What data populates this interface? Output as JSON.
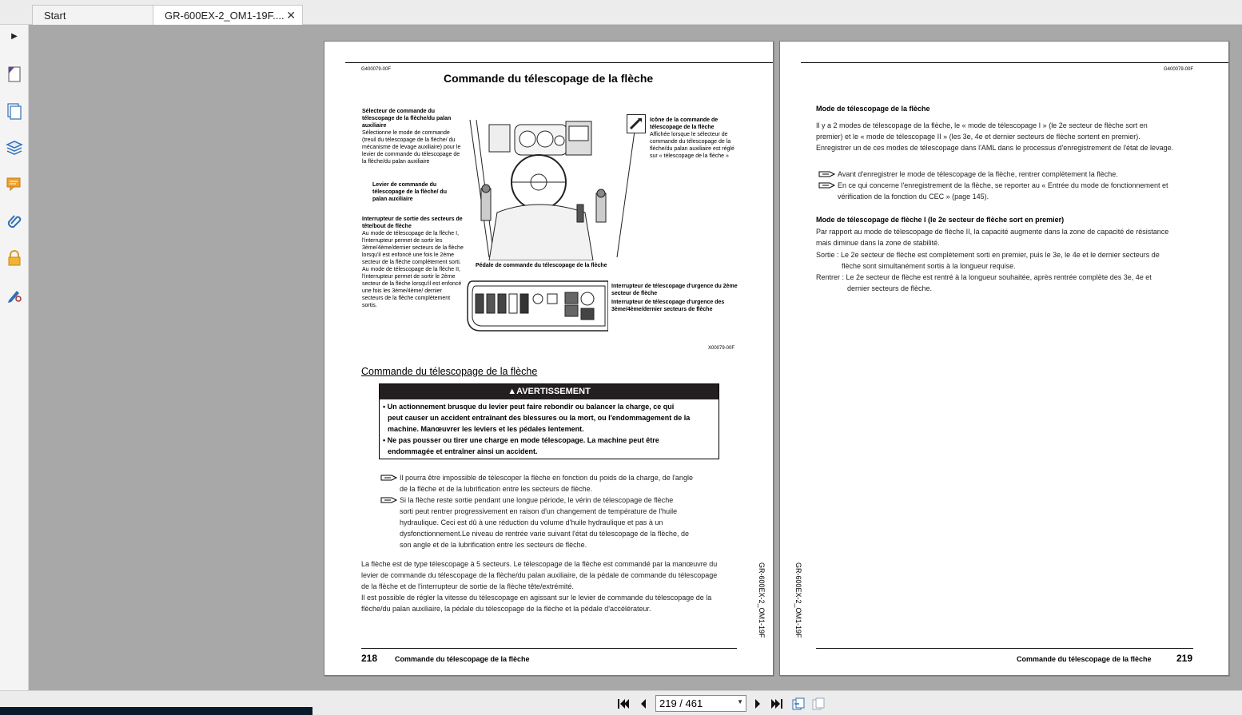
{
  "tabs": [
    {
      "label": "Start"
    },
    {
      "label": "GR-600EX-2_OM1-19F....",
      "close": "✕"
    }
  ],
  "sidebar": {
    "expand_arrow": "▶",
    "items": [
      "page-thumbnails",
      "layers-pages",
      "layers",
      "comments",
      "attachments",
      "security",
      "sign"
    ]
  },
  "left_page": {
    "doc_code": "G400079-00F",
    "title": "Commande du télescopage de la flèche",
    "callouts": {
      "c1_title": "Sélecteur de commande du télescopage de la flèche/du palan auxiliaire",
      "c1_text": "Sélectionne le mode de commande (treuil du télescopage de la flèche/ du mécanisme de levage auxiliaire) pour le levier de commande du télescopage de la flèche/du palan auxiliaire",
      "c2_title": "Levier de commande du télescopage de la flèche/ du palan auxiliaire",
      "c3_title": "Interrupteur de sortie des secteurs de tête/bout de flèche",
      "c3_text": "Au mode de télescopage de la flèche I, l'interrupteur permet de sortir les 3ème/4ème/dernier secteurs de la flèche lorsqu'il est enfoncé une fois le 2ème secteur de la flèche complètement sorti. Au mode de télescopage de la flèche II, l'interrupteur permet de sortir le 2ème secteur de la flèche lorsqu'il est enfoncé une fois les 3ème/4ème/ dernier secteurs de la flèche complètement sortis.",
      "c4_title": "Icône de la commande de télescopage de la flèche",
      "c4_text": "Affichée lorsque le sélecteur de commande du télescopage de la flèche/du palan auxiliaire est réglé sur « télescopage de la flèche »",
      "c5_title": "Pédale de commande du télescopage de la flèche",
      "c6_title": "Interrupteur de télescopage d'urgence du 2ème secteur de flèche",
      "c7_title": "Interrupteur de télescopage d'urgence des 3ème/4ème/dernier secteurs de flèche",
      "figure_code": "X00079-00F"
    },
    "section_title": "Commande du télescopage de la flèche",
    "warning": {
      "head": "AVERTISSEMENT",
      "items": [
        "Un actionnement brusque du levier peut faire rebondir ou balancer la charge, ce qui",
        "peut causer un accident entraînant des blessures ou la mort, ou l'endommagement de la",
        "machine. Manœuvrer les leviers et les pédales lentement.",
        "Ne pas pousser ou tirer une charge en mode télescopage. La machine peut être",
        "endommagée et entraîner ainsi un accident."
      ]
    },
    "notes": [
      "Il pourra être impossible de télescoper la flèche en fonction du poids de la charge, de l'angle",
      "de la flèche et de la lubrification entre les secteurs de flèche.",
      "Si la flèche reste sortie pendant une longue période, le vérin de télescopage de flèche",
      "sorti peut rentrer progressivement en raison d'un changement de température de l'huile",
      "hydraulique.  Ceci est dû à une réduction du volume d'huile hydraulique et pas à un",
      "dysfonctionnement.Le niveau de rentrée varie suivant l'état du télescopage de la flèche, de",
      "son angle et de la lubrification entre les secteurs de flèche."
    ],
    "body": [
      "La flèche est de type télescopage à 5 secteurs. Le télescopage de la flèche est commandé par la manœuvre du",
      "levier de commande du télescopage de la flèche/du palan auxiliaire, de la pédale de commande du télescopage",
      "de la flèche et de l'interrupteur de sortie de la flèche tête/extrémité.",
      "Il est possible de régler la vitesse du télescopage en agissant sur le levier de commande du télescopage de la",
      "flèche/du palan auxiliaire, la pédale du télescopage de la flèche et la pédale d'accélérateur."
    ],
    "footer_num": "218",
    "footer_title": "Commande du télescopage de la flèche",
    "side_code": "GR-600EX-2_OM1-19F"
  },
  "right_page": {
    "doc_code": "G400079-00F",
    "h_mode": "Mode de télescopage de la flèche",
    "p1": [
      "Il y a 2 modes de télescopage de la flèche, le « mode de télescopage I » (le 2e secteur de flèche sort en",
      "premier) et le « mode de télescopage II » (les 3e, 4e et dernier secteurs de flèche sortent en premier).",
      "Enregistrer un de ces modes de télescopage dans l'AML dans le processus d'enregistrement de l'état de levage."
    ],
    "notes": [
      "Avant d'enregistrer le mode de télescopage de la flèche, rentrer complètement la flèche.",
      "En ce qui concerne l'enregistrement de la flèche, se reporter au « Entrée du mode de fonctionnement et",
      "vérification de la fonction du CEC » (page 145)."
    ],
    "h_mode1": "Mode de télescopage de flèche I (le 2e secteur de flèche sort en premier)",
    "p2": [
      "Par rapport au mode de télescopage de flèche II, la capacité augmente dans la zone de capacité de résistance",
      "mais diminue dans la zone de stabilité."
    ],
    "sortie_label": "Sortie :",
    "sortie": [
      "Le 2e secteur de flèche est complètement sorti en premier, puis le 3e, le 4e et le dernier secteurs de",
      "flèche sont simultanément sortis à la longueur requise."
    ],
    "rentrer_label": "Rentrer :",
    "rentrer": [
      "Le 2e secteur de flèche est rentré à la longueur souhaitée, après rentrée complète des 3e, 4e et",
      "dernier secteurs de flèche."
    ],
    "footer_num": "219",
    "footer_title": "Commande du télescopage de la flèche",
    "side_code": "GR-600EX-2_OM1-19F"
  },
  "nav": {
    "page_display": "219 / 461"
  }
}
